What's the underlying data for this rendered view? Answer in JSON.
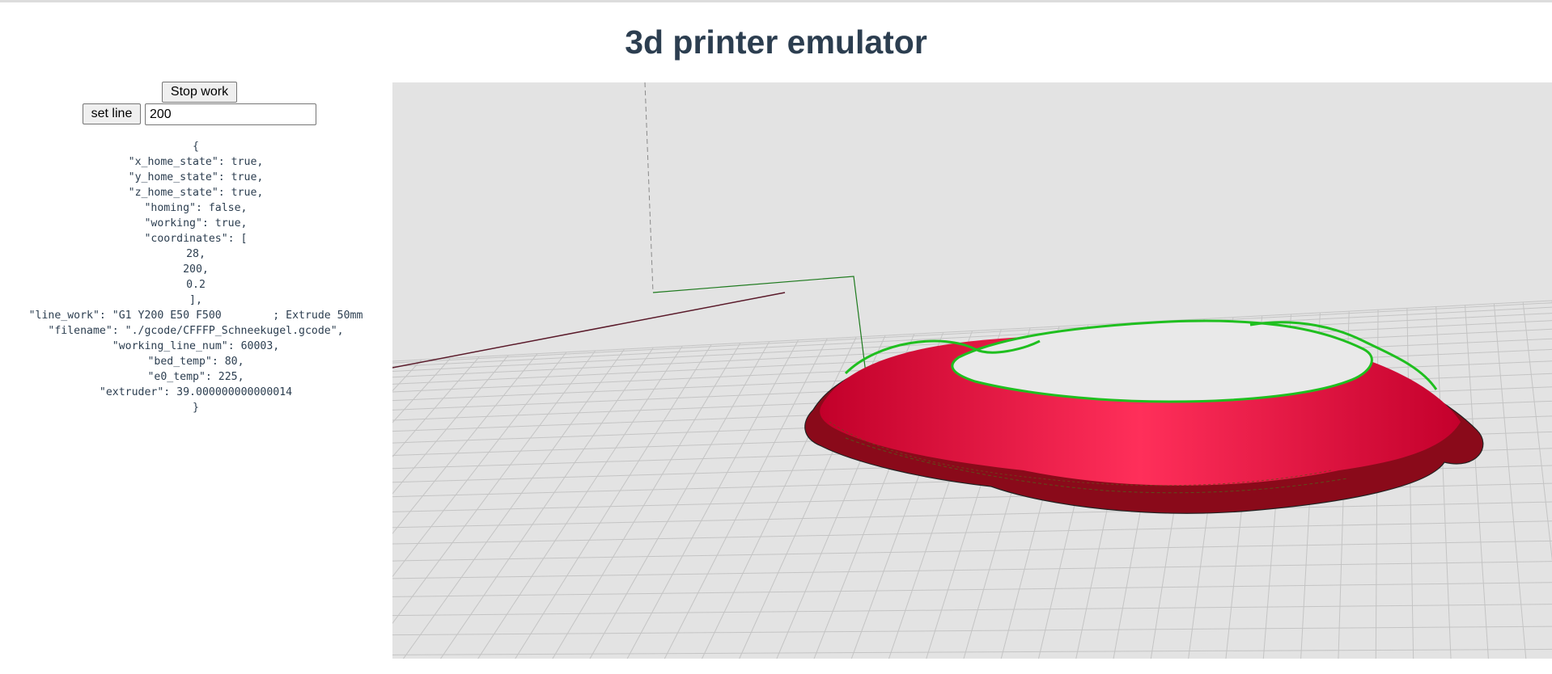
{
  "page": {
    "title": "3d printer emulator"
  },
  "controls": {
    "stop_label": "Stop work",
    "set_line_label": "set line",
    "line_value": "200"
  },
  "status_lines": [
    "{",
    "\"x_home_state\": true,",
    "\"y_home_state\": true,",
    "\"z_home_state\": true,",
    "\"homing\": false,",
    "\"working\": true,",
    "\"coordinates\": [",
    "28,",
    "200,",
    "0.2",
    "],",
    "\"line_work\": \"G1 Y200 E50 F500        ; Extrude 50mm",
    "\"filename\": \"./gcode/CFFFP_Schneekugel.gcode\",",
    "\"working_line_num\": 60003,",
    "\"bed_temp\": 80,",
    "\"e0_temp\": 225,",
    "\"extruder\": 39.000000000000014",
    "}"
  ],
  "colors": {
    "title": "#2c3e50",
    "viewport_bg": "#e3e3e3",
    "grid_line": "#c6c6c6",
    "model_red": "#f0204a",
    "toolpath_green": "#2fbf2f",
    "travel_green": "#1e7a1e"
  }
}
